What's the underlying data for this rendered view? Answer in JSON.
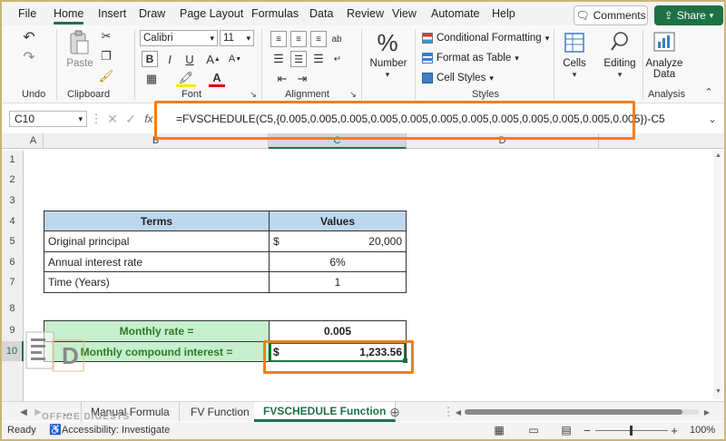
{
  "menu": {
    "tabs": [
      "File",
      "Home",
      "Insert",
      "Draw",
      "Page Layout",
      "Formulas",
      "Data",
      "Review",
      "View",
      "Automate",
      "Help"
    ],
    "active": "Home",
    "comments_label": "Comments",
    "share_label": "Share"
  },
  "ribbon": {
    "groups": {
      "undo": "Undo",
      "clipboard": "Clipboard",
      "font": "Font",
      "alignment": "Alignment",
      "styles": "Styles",
      "analysis": "Analysis"
    },
    "paste_label": "Paste",
    "font_name": "Calibri",
    "font_size": "11",
    "number_label": "Number",
    "conditional_formatting": "Conditional Formatting",
    "format_as_table": "Format as Table",
    "cell_styles": "Cell Styles",
    "cells_label": "Cells",
    "editing_label": "Editing",
    "analyze_data_label": "Analyze Data"
  },
  "formula_bar": {
    "name_box": "C10",
    "formula": "=FVSCHEDULE(C5,{0.005,0.005,0.005,0.005,0.005,0.005,0.005,0.005,0.005,0.005,0.005,0.005})-C5"
  },
  "grid": {
    "columns": [
      "A",
      "B",
      "C",
      "D"
    ],
    "rows": [
      "1",
      "2",
      "3",
      "4",
      "5",
      "6",
      "7",
      "8",
      "9",
      "10"
    ],
    "table": {
      "header_terms": "Terms",
      "header_values": "Values",
      "rows": [
        {
          "label": "Original principal",
          "currency": "$",
          "value": "20,000"
        },
        {
          "label": "Annual interest rate",
          "currency": "",
          "value": "6%"
        },
        {
          "label": "Time (Years)",
          "currency": "",
          "value": "1"
        }
      ]
    },
    "result": {
      "monthly_rate_label": "Monthly rate =",
      "monthly_rate_value": "0.005",
      "compound_label": "Monthly compound interest =",
      "compound_currency": "$",
      "compound_value": "1,233.56"
    }
  },
  "sheets": {
    "tabs": [
      "...",
      "Manual Formula",
      "FV Function",
      "FVSCHEDULE Function"
    ],
    "active": "FVSCHEDULE Function"
  },
  "status": {
    "ready": "Ready",
    "accessibility": "Accessibility: Investigate",
    "zoom": "100%"
  },
  "watermark": "OFFICE DIGESTS",
  "colors": {
    "excel_green": "#1e7145",
    "highlight_orange": "#f07f1a",
    "header_blue": "#bdd7ee",
    "result_green": "#c6efce",
    "result_text": "#2f7b22"
  }
}
